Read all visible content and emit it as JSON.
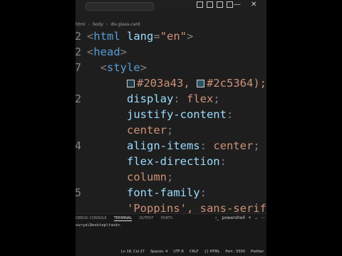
{
  "breadcrumb": [
    "html",
    "body",
    "div.glass-card"
  ],
  "code_lines": [
    {
      "num": "2",
      "tokens": [
        {
          "t": "<",
          "c": "punc"
        },
        {
          "t": "html ",
          "c": "tag"
        },
        {
          "t": "lang",
          "c": "attr"
        },
        {
          "t": "=",
          "c": "punc"
        },
        {
          "t": "\"en\"",
          "c": "str"
        },
        {
          "t": ">",
          "c": "punc"
        }
      ]
    },
    {
      "num": "2",
      "tokens": [
        {
          "t": "<",
          "c": "punc"
        },
        {
          "t": "head",
          "c": "tag"
        },
        {
          "t": ">",
          "c": "punc"
        }
      ]
    },
    {
      "num": "7",
      "tokens": [
        {
          "t": "  <",
          "c": "punc"
        },
        {
          "t": "style",
          "c": "tag"
        },
        {
          "t": ">",
          "c": "punc"
        }
      ]
    },
    {
      "num": "",
      "tokens": [
        {
          "t": "      ",
          "c": ""
        },
        {
          "swatch": "#203a43"
        },
        {
          "t": "#203a43, ",
          "c": "val"
        },
        {
          "swatch": "#2c5364"
        },
        {
          "t": "#2c5364);",
          "c": "val"
        }
      ]
    },
    {
      "num": "2",
      "tokens": [
        {
          "t": "      display",
          "c": "prop"
        },
        {
          "t": ": ",
          "c": "punc"
        },
        {
          "t": "flex",
          "c": "val"
        },
        {
          "t": ";",
          "c": "punc"
        }
      ]
    },
    {
      "num": "",
      "tokens": [
        {
          "t": "      justify-content",
          "c": "prop"
        },
        {
          "t": ":",
          "c": "punc"
        }
      ]
    },
    {
      "num": "",
      "tokens": [
        {
          "t": "      center",
          "c": "val"
        },
        {
          "t": ";",
          "c": "punc"
        }
      ]
    },
    {
      "num": "4",
      "tokens": [
        {
          "t": "      align-items",
          "c": "prop"
        },
        {
          "t": ": ",
          "c": "punc"
        },
        {
          "t": "center",
          "c": "val"
        },
        {
          "t": ";",
          "c": "punc"
        }
      ]
    },
    {
      "num": "",
      "tokens": [
        {
          "t": "      flex-direction",
          "c": "prop"
        },
        {
          "t": ":",
          "c": "punc"
        }
      ]
    },
    {
      "num": "",
      "tokens": [
        {
          "t": "      column",
          "c": "val"
        },
        {
          "t": ";",
          "c": "punc"
        }
      ]
    },
    {
      "num": "5",
      "tokens": [
        {
          "t": "      font-family",
          "c": "prop"
        },
        {
          "t": ":",
          "c": "punc"
        }
      ]
    },
    {
      "num": "",
      "tokens": [
        {
          "t": "      'Poppins', sans-serif;",
          "c": "val"
        }
      ]
    }
  ],
  "panel": {
    "tabs": [
      "DEBUG CONSOLE",
      "TERMINAL",
      "OUTPUT",
      "PORTS"
    ],
    "active_tab": "TERMINAL",
    "shell": "powershell",
    "prompt": "surya\\Desktop\\task>"
  },
  "status": {
    "items": [
      "Ln 18, Col 27",
      "Spaces: 4",
      "UTF-8",
      "CRLF",
      "{} HTML",
      "Port : 5500",
      "Prettier"
    ]
  }
}
